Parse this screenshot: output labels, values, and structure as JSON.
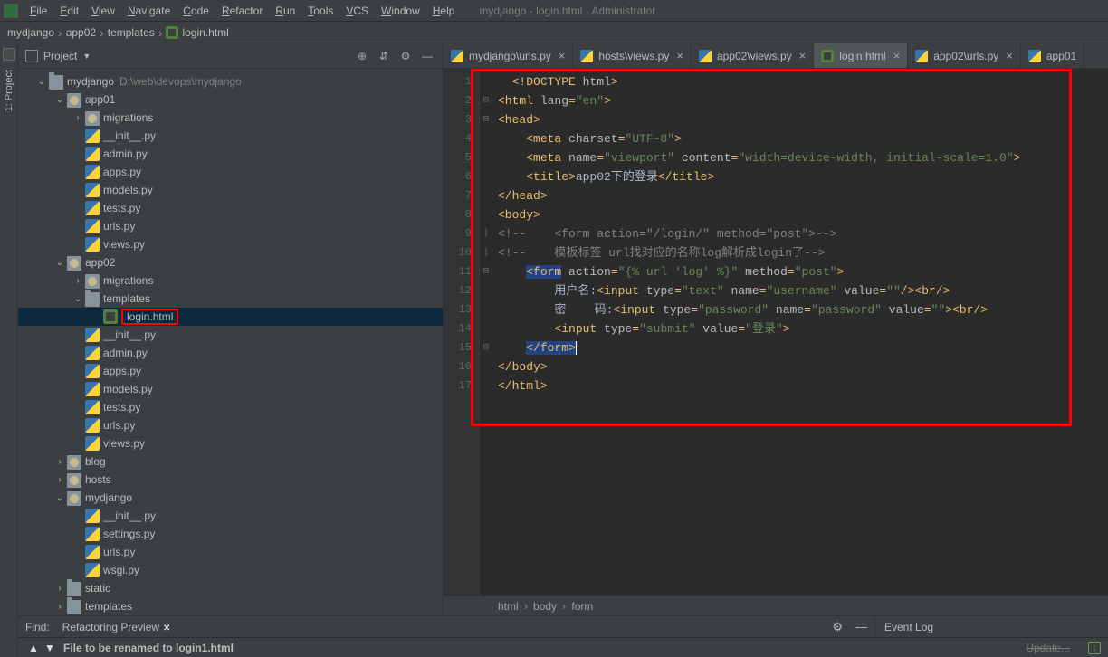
{
  "window_title_extra": "mydjango - login.html - Administrator",
  "menu": [
    "File",
    "Edit",
    "View",
    "Navigate",
    "Code",
    "Refactor",
    "Run",
    "Tools",
    "VCS",
    "Window",
    "Help"
  ],
  "navbar": [
    "mydjango",
    "app02",
    "templates",
    "login.html"
  ],
  "toolwindow_label": "1: Project",
  "project_header": "Project",
  "project_root": "mydjango",
  "project_root_hint": "D:\\web\\devops\\mydjango",
  "tree": [
    {
      "d": 0,
      "k": "dir",
      "n": "mydjango",
      "hint": "D:\\web\\devops\\mydjango",
      "exp": true
    },
    {
      "d": 1,
      "k": "pkg",
      "n": "app01",
      "exp": true
    },
    {
      "d": 2,
      "k": "pkg",
      "n": "migrations",
      "exp": false,
      "arrow": "r"
    },
    {
      "d": 2,
      "k": "py",
      "n": "__init__.py"
    },
    {
      "d": 2,
      "k": "py",
      "n": "admin.py"
    },
    {
      "d": 2,
      "k": "py",
      "n": "apps.py"
    },
    {
      "d": 2,
      "k": "py",
      "n": "models.py"
    },
    {
      "d": 2,
      "k": "py",
      "n": "tests.py"
    },
    {
      "d": 2,
      "k": "py",
      "n": "urls.py"
    },
    {
      "d": 2,
      "k": "py",
      "n": "views.py"
    },
    {
      "d": 1,
      "k": "pkg",
      "n": "app02",
      "exp": true
    },
    {
      "d": 2,
      "k": "pkg",
      "n": "migrations",
      "exp": false,
      "arrow": "r"
    },
    {
      "d": 2,
      "k": "dir",
      "n": "templates",
      "exp": true
    },
    {
      "d": 3,
      "k": "html",
      "n": "login.html",
      "sel": true,
      "red": true
    },
    {
      "d": 2,
      "k": "py",
      "n": "__init__.py"
    },
    {
      "d": 2,
      "k": "py",
      "n": "admin.py"
    },
    {
      "d": 2,
      "k": "py",
      "n": "apps.py"
    },
    {
      "d": 2,
      "k": "py",
      "n": "models.py"
    },
    {
      "d": 2,
      "k": "py",
      "n": "tests.py"
    },
    {
      "d": 2,
      "k": "py",
      "n": "urls.py"
    },
    {
      "d": 2,
      "k": "py",
      "n": "views.py"
    },
    {
      "d": 1,
      "k": "pkg",
      "n": "blog",
      "exp": false,
      "arrow": "r"
    },
    {
      "d": 1,
      "k": "pkg",
      "n": "hosts",
      "exp": false,
      "arrow": "r"
    },
    {
      "d": 1,
      "k": "pkg",
      "n": "mydjango",
      "exp": true
    },
    {
      "d": 2,
      "k": "py",
      "n": "__init__.py"
    },
    {
      "d": 2,
      "k": "py",
      "n": "settings.py"
    },
    {
      "d": 2,
      "k": "py",
      "n": "urls.py"
    },
    {
      "d": 2,
      "k": "py",
      "n": "wsgi.py"
    },
    {
      "d": 1,
      "k": "dir",
      "n": "static",
      "exp": false,
      "arrow": "r"
    },
    {
      "d": 1,
      "k": "dir",
      "n": "templates",
      "exp": false,
      "arrow": "r"
    }
  ],
  "tabs": [
    {
      "icon": "py",
      "label": "mydjango\\urls.py",
      "active": false
    },
    {
      "icon": "py",
      "label": "hosts\\views.py",
      "active": false
    },
    {
      "icon": "py",
      "label": "app02\\views.py",
      "active": false
    },
    {
      "icon": "html",
      "label": "login.html",
      "active": true
    },
    {
      "icon": "py",
      "label": "app02\\urls.py",
      "active": false
    },
    {
      "icon": "py",
      "label": "app01",
      "active": false,
      "noclose": true
    }
  ],
  "lines": 17,
  "code_text": {
    "l1": "<!DOCTYPE html>",
    "title": "app02下的登录",
    "form_action": "{% url 'log' %}",
    "cmt1": "<form action=\"/login/\" method=\"post\">",
    "cmt2": "模板标签 url找对应的名称log解析成login了",
    "label_user": "用户名:",
    "label_pass": "密    码:",
    "submit_value": "登录"
  },
  "crumbs": [
    "html",
    "body",
    "form"
  ],
  "findbar": {
    "find": "Find:",
    "ref": "Refactoring Preview"
  },
  "eventlog": "Event Log",
  "status": {
    "msg": "File to be renamed to login1.html",
    "upd": "Update..."
  }
}
